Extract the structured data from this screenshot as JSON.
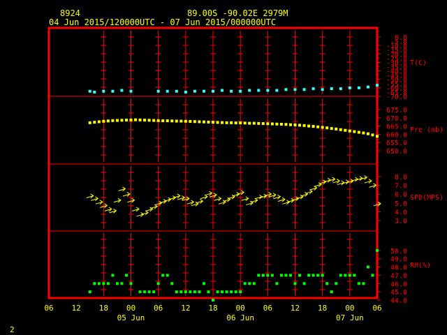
{
  "header": {
    "station_id": "8924",
    "location": "89.00S   -90.02E   2979M",
    "period": "04 Jun 2015/120000UTC - 07 Jun 2015/000000UTC"
  },
  "footer_page": "2",
  "colors": {
    "background": "#000000",
    "frame": "#ff0000",
    "text": "#ffff00",
    "temperature": "#33ffff",
    "pressure": "#ffff00",
    "wind": "#ffff00",
    "humidity": "#00ff00"
  },
  "chart_data": {
    "type": "scatter",
    "x_hour_ticks": [
      "06",
      "12",
      "18",
      "00",
      "06",
      "12",
      "18",
      "00",
      "06",
      "12",
      "18",
      "00",
      "06"
    ],
    "x_date_labels": [
      "05 Jun",
      "06 Jun",
      "07 Jun"
    ],
    "x_range_hours": [
      -6,
      66
    ],
    "panels": [
      {
        "name": "T(C)",
        "ylim": [
          -70,
          0
        ],
        "ticks": [
          "0.0",
          "-10.0",
          "-20.0",
          "-30.0",
          "-40.0",
          "-50.0",
          "-60.0",
          "-70.0"
        ],
        "minor_ticks": [
          "-5.0",
          "-15.0",
          "-25.0",
          "-35.0",
          "-45.0",
          "-55.0",
          "-65.0"
        ],
        "x": [
          3,
          4,
          6,
          8,
          10,
          12,
          18,
          20,
          22,
          24,
          26,
          28,
          30,
          32,
          34,
          36,
          38,
          40,
          42,
          44,
          46,
          48,
          50,
          52,
          54,
          56,
          58,
          60,
          62,
          64,
          66
        ],
        "values": [
          -64,
          -65,
          -64,
          -64,
          -63,
          -64,
          -64,
          -64,
          -64,
          -65,
          -64,
          -64,
          -64,
          -63,
          -64,
          -64,
          -63,
          -63,
          -63,
          -63,
          -62,
          -62,
          -62,
          -61,
          -62,
          -61,
          -61,
          -60,
          -60,
          -59,
          -57
        ]
      },
      {
        "name": "Pre (mb)",
        "ylim": [
          650,
          675
        ],
        "ticks": [
          "675.0",
          "670.0",
          "665.0",
          "660.0",
          "655.0",
          "650.0"
        ],
        "x": [
          3,
          4,
          5,
          6,
          7,
          8,
          9,
          10,
          11,
          12,
          13,
          14,
          15,
          16,
          17,
          18,
          19,
          20,
          21,
          22,
          23,
          24,
          25,
          26,
          27,
          28,
          29,
          30,
          31,
          32,
          33,
          34,
          35,
          36,
          37,
          38,
          39,
          40,
          41,
          42,
          43,
          44,
          45,
          46,
          47,
          48,
          49,
          50,
          51,
          52,
          53,
          54,
          55,
          56,
          57,
          58,
          59,
          60,
          61,
          62,
          63,
          64,
          65,
          66
        ],
        "values": [
          667.0,
          667.3,
          667.6,
          667.9,
          668.1,
          668.3,
          668.4,
          668.5,
          668.6,
          668.7,
          668.8,
          668.7,
          668.6,
          668.5,
          668.4,
          668.3,
          668.2,
          668.2,
          668.1,
          668.0,
          668.0,
          667.9,
          667.8,
          667.7,
          667.6,
          667.5,
          667.4,
          667.3,
          667.2,
          667.1,
          667.0,
          667.0,
          666.9,
          666.9,
          666.8,
          666.7,
          666.7,
          666.6,
          666.5,
          666.4,
          666.3,
          666.2,
          666.1,
          666.0,
          665.8,
          665.7,
          665.5,
          665.3,
          665.0,
          664.8,
          664.5,
          664.2,
          663.9,
          663.5,
          663.2,
          662.8,
          662.4,
          662.0,
          661.6,
          661.2,
          660.8,
          660.3,
          659.6,
          658.8
        ]
      },
      {
        "name": "SPD(MPS)",
        "ylim": [
          3,
          8
        ],
        "ticks": [
          "8.0",
          "7.0",
          "6.0",
          "5.0",
          "4.0",
          "3.0"
        ],
        "x": [
          3,
          4,
          5,
          6,
          7,
          8,
          9,
          10,
          11,
          12,
          13,
          14,
          15,
          16,
          17,
          18,
          19,
          20,
          21,
          22,
          23,
          24,
          25,
          26,
          27,
          28,
          29,
          30,
          31,
          32,
          33,
          34,
          35,
          36,
          37,
          38,
          39,
          40,
          41,
          42,
          43,
          44,
          45,
          46,
          47,
          48,
          49,
          50,
          51,
          52,
          53,
          54,
          55,
          56,
          57,
          58,
          59,
          60,
          61,
          62,
          63,
          64,
          65,
          66
        ],
        "values": [
          5.7,
          5.4,
          5.0,
          4.6,
          4.2,
          4.0,
          5.2,
          6.5,
          5.9,
          5.2,
          4.2,
          3.6,
          3.8,
          4.2,
          4.5,
          4.9,
          5.1,
          5.3,
          5.5,
          5.7,
          5.5,
          5.4,
          5.0,
          4.8,
          5.1,
          5.6,
          6.0,
          5.8,
          5.4,
          5.0,
          5.3,
          5.6,
          5.9,
          6.1,
          5.4,
          4.9,
          5.2,
          5.6,
          5.7,
          5.9,
          5.8,
          5.6,
          5.3,
          5.0,
          5.2,
          5.4,
          5.6,
          5.9,
          6.2,
          6.6,
          7.0,
          7.3,
          7.5,
          7.6,
          7.4,
          7.2,
          7.3,
          7.4,
          7.6,
          7.7,
          7.8,
          7.4,
          6.9,
          4.8
        ]
      },
      {
        "name": "RH(%)",
        "ylim": [
          44,
          51
        ],
        "ticks": [
          "50.0",
          "49.0",
          "48.0",
          "47.0",
          "46.0",
          "45.0",
          "44.0"
        ],
        "x": [
          3,
          4,
          5,
          6,
          7,
          8,
          9,
          10,
          11,
          12,
          14,
          15,
          16,
          17,
          18,
          19,
          20,
          21,
          22,
          23,
          24,
          25,
          26,
          27,
          28,
          29,
          30,
          31,
          32,
          33,
          34,
          35,
          36,
          37,
          38,
          39,
          40,
          41,
          42,
          43,
          44,
          45,
          46,
          47,
          48,
          49,
          50,
          51,
          52,
          53,
          54,
          55,
          56,
          57,
          58,
          59,
          60,
          61,
          62,
          63,
          64,
          65,
          66
        ],
        "values": [
          45,
          46,
          46,
          46,
          46,
          47,
          46,
          46,
          47,
          46,
          45,
          45,
          45,
          45,
          46,
          47,
          47,
          46,
          45,
          45,
          45,
          45,
          45,
          45,
          46,
          45,
          44,
          45,
          45,
          45,
          45,
          45,
          45,
          46,
          46,
          46,
          47,
          47,
          47,
          47,
          46,
          47,
          47,
          47,
          46,
          47,
          46,
          47,
          47,
          47,
          47,
          46,
          45,
          46,
          47,
          47,
          47,
          47,
          46,
          46,
          48,
          47,
          50
        ]
      }
    ]
  }
}
